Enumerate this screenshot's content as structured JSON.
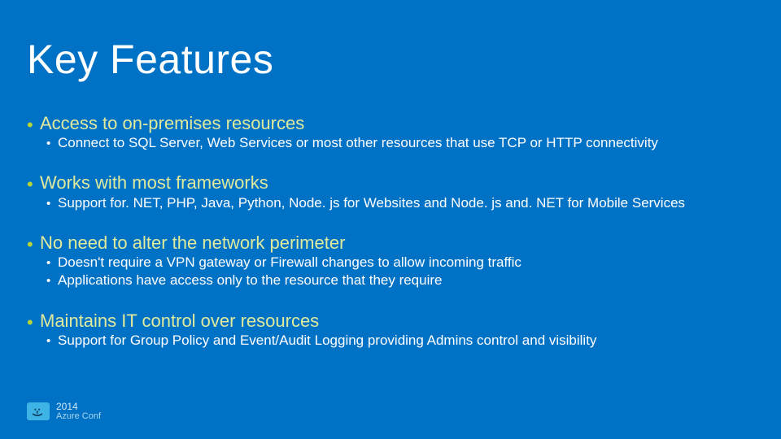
{
  "title": "Key Features",
  "bullets": [
    {
      "text": "Access to on-premises resources",
      "sub": [
        "Connect to SQL Server, Web Services or most other resources that use TCP or HTTP connectivity"
      ]
    },
    {
      "text": "Works with most frameworks",
      "sub": [
        "Support for. NET, PHP, Java, Python, Node. js for Websites and Node. js and. NET for Mobile Services"
      ]
    },
    {
      "text": "No need to alter the network perimeter",
      "sub": [
        "Doesn't require a VPN gateway or Firewall changes to allow incoming traffic",
        "Applications have access only to the resource that they require"
      ]
    },
    {
      "text": "Maintains IT control over resources",
      "sub": [
        "Support for Group Policy and Event/Audit Logging providing Admins control and visibility"
      ]
    }
  ],
  "footer": {
    "year": "2014",
    "brand": "Azure Conf",
    "face": ":-)"
  }
}
